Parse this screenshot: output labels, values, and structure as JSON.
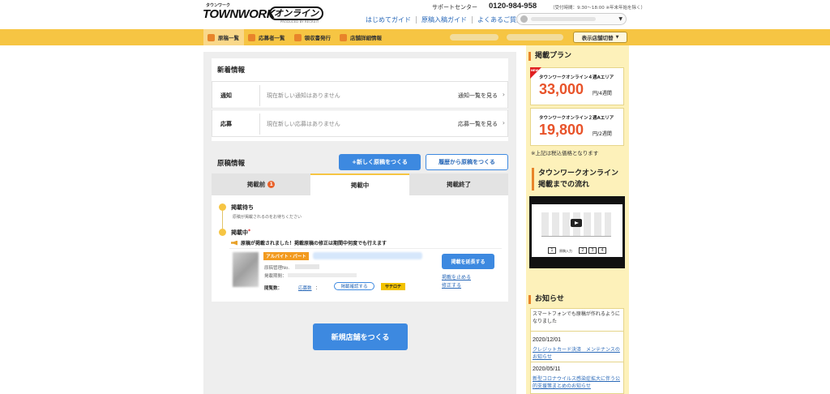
{
  "header": {
    "logo_small": "タウンワーク",
    "logo_main": "TOWNWORK",
    "logo_online": "オンライン",
    "logo_by": "PRODUCED BY RECRUIT",
    "support_label": "サポートセンター",
    "phone": "0120-984-958",
    "hours": "（受付時間：9:30～18:00 ※年末年始を除く）",
    "links": [
      "はじめてガイド",
      "原稿入稿ガイド",
      "よくあるご質問"
    ]
  },
  "nav": {
    "items": [
      "原稿一覧",
      "応募者一覧",
      "領収書発行",
      "店舗詳細情報"
    ],
    "store_switch": "表示店舗切替"
  },
  "news": {
    "title": "新着情報",
    "rows": [
      {
        "label": "通知",
        "text": "現在新しい通知はありません",
        "link": "通知一覧を見る"
      },
      {
        "label": "応募",
        "text": "現在新しい応募はありません",
        "link": "応募一覧を見る"
      }
    ]
  },
  "manuscript": {
    "title": "原稿情報",
    "btn_new": "+新しく原稿をつくる",
    "btn_history": "履歴から原稿をつくる",
    "tabs": [
      {
        "label": "掲載前",
        "badge": "1"
      },
      {
        "label": "掲載中"
      },
      {
        "label": "掲載終了"
      }
    ],
    "status1": "掲載待ち",
    "status1_sub": "原稿が掲載されるのをお待ちください",
    "status2": "掲載中",
    "status2_mark": "*",
    "notice": "原稿が掲載されました！掲載原稿の修正は期間中何度でも行えます",
    "job": {
      "tag": "アルバイト・パート",
      "id_label": "原稿管理No.",
      "period_label": "掲載期間：",
      "views_label": "閲覧数：",
      "apply_label": "応募数",
      "apply_colon": "：",
      "confirm": "掲載確認する",
      "satoroku": "サテロテ",
      "btn_extend": "掲載を延長する",
      "stop": "掲載を止める",
      "fix": "修正する"
    }
  },
  "create_store": "新規店舗をつくる",
  "side": {
    "plan_title": "掲載プラン",
    "plans": [
      {
        "name": "タウンワークオンライン４週Aエリア",
        "price": "33,000",
        "unit": "円/4週間",
        "badge": "NEW"
      },
      {
        "name": "タウンワークオンライン２週Aエリア",
        "price": "19,800",
        "unit": "円/2週間"
      }
    ],
    "tax_note": "※上記は税込価格となります",
    "flow_title": "タウンワークオンライン\n掲載までの流れ",
    "flow_caption": "原稿入力",
    "flow_steps": [
      "1",
      "2",
      "3",
      "4"
    ],
    "news_title": "お知らせ",
    "news_intro": "スマートフォンでも原稿が作れるようになりました",
    "news_items": [
      {
        "date": "2020/12/01",
        "text": "クレジットカード決済　メンテナンスのお知らせ"
      },
      {
        "date": "2020/05/11",
        "text": "新型コロナウイルス感染症拡大に伴う公的支援策まとめのお知らせ"
      }
    ]
  }
}
